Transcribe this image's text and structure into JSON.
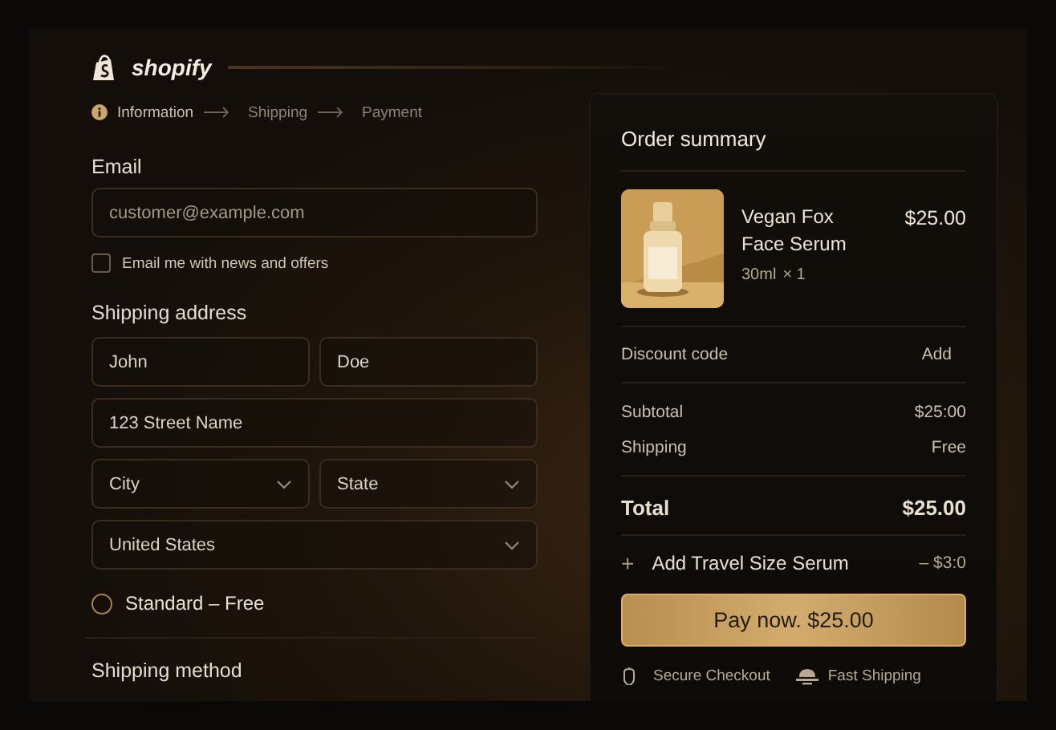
{
  "brand": {
    "name": "shopify"
  },
  "breadcrumb": [
    {
      "label": "Information",
      "selected": true
    },
    {
      "label": "Shipping",
      "selected": false
    },
    {
      "label": "Payment",
      "selected": false
    }
  ],
  "contact": {
    "label": "Email",
    "field": {
      "placeholder": "customer@example.com"
    },
    "newsletter": {
      "label": "Email me with news and offers",
      "checked": false
    }
  },
  "shipping_address": {
    "label": "Shipping address",
    "rows": [
      [
        {
          "kind": "text",
          "value": "John"
        },
        {
          "kind": "text",
          "value": "Doe"
        }
      ],
      [
        {
          "kind": "text",
          "value": "123 Street Name"
        }
      ],
      [
        {
          "kind": "select",
          "value": "City"
        },
        {
          "kind": "select",
          "value": "State"
        }
      ],
      [
        {
          "kind": "select",
          "value": "United States"
        }
      ]
    ]
  },
  "shipping_options": [
    {
      "label": "Standard – Free",
      "selected": false
    }
  ],
  "shipping_method": {
    "label": "Shipping method"
  },
  "order_summary": {
    "title": "Order summary",
    "product": {
      "name": "Vegan Fox Face Serum",
      "variant": "30ml",
      "quantity": "× 1",
      "price": "$25.00"
    },
    "discount": {
      "label": "Discount code",
      "action": "Add"
    },
    "lines": [
      {
        "label": "Subtotal",
        "value": "$25:00"
      },
      {
        "label": "Shipping",
        "value": "Free"
      }
    ],
    "total": {
      "label": "Total",
      "value": "$25.00"
    },
    "upsell": {
      "icon": "+",
      "label": "Add Travel Size Serum",
      "value": "– $3:0"
    },
    "pay_button": "Pay now. $25.00",
    "badges": [
      {
        "kind": "shield",
        "label": "Secure Checkout"
      },
      {
        "kind": "truck",
        "label": "Fast Shipping"
      }
    ]
  }
}
